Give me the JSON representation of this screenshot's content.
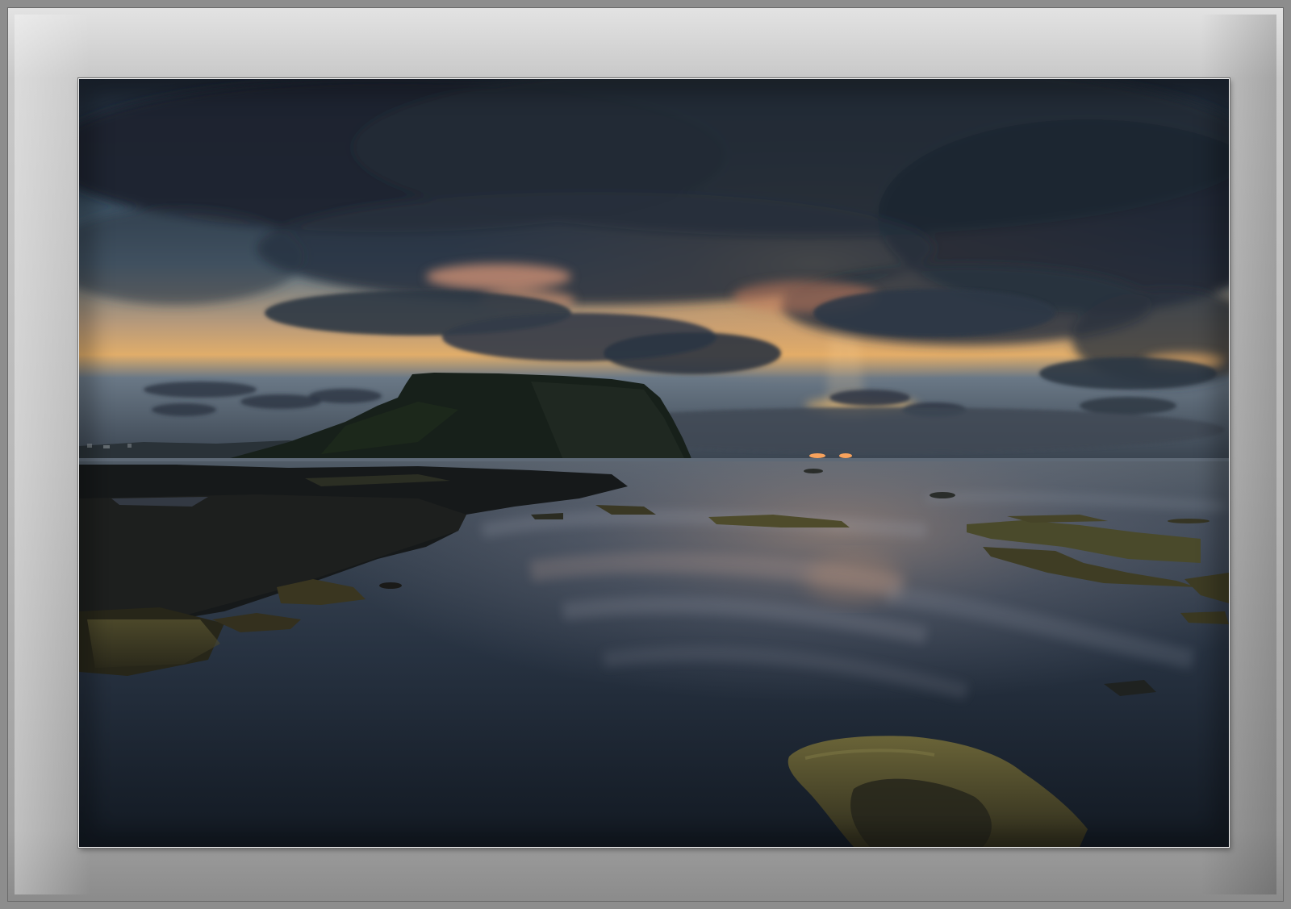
{
  "scene": {
    "subject": "",
    "palette": {
      "mat_top": "#e3e3e3",
      "mat_bottom": "#8b8b8b",
      "sky_dark": "#1f2b3a",
      "sky_blue": "#5f7c96",
      "horizon_glow": "#f3b15a",
      "cloud_warm": "#c98a6a",
      "headland": "#1a2418",
      "sea": "#2b3747",
      "rock_moss": "#4b4a2a"
    }
  }
}
